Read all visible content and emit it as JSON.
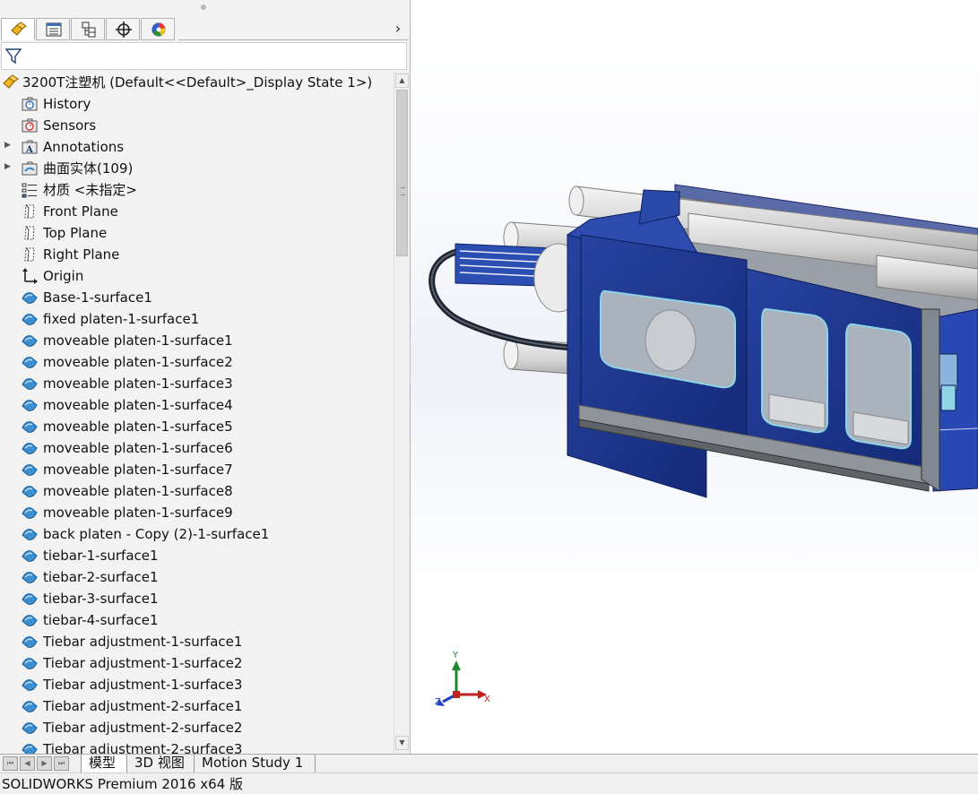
{
  "panel_tabs": [
    {
      "icon": "feature-manager-icon",
      "active": true
    },
    {
      "icon": "property-manager-icon",
      "active": false
    },
    {
      "icon": "configuration-manager-icon",
      "active": false
    },
    {
      "icon": "dimxpert-manager-icon",
      "active": false
    },
    {
      "icon": "display-manager-icon",
      "active": false
    }
  ],
  "tree": {
    "root_label": "3200T注塑机  (Default<<Default>_Display State 1>)",
    "items": [
      {
        "label": "History",
        "icon": "history-folder-icon",
        "expandable": false
      },
      {
        "label": "Sensors",
        "icon": "sensors-folder-icon",
        "expandable": false
      },
      {
        "label": "Annotations",
        "icon": "annotations-folder-icon",
        "expandable": true
      },
      {
        "label": "曲面实体(109)",
        "icon": "surface-bodies-folder-icon",
        "expandable": true
      },
      {
        "label": "材质 <未指定>",
        "icon": "material-icon",
        "expandable": false
      },
      {
        "label": "Front Plane",
        "icon": "plane-icon",
        "expandable": false
      },
      {
        "label": "Top Plane",
        "icon": "plane-icon",
        "expandable": false
      },
      {
        "label": "Right Plane",
        "icon": "plane-icon",
        "expandable": false
      },
      {
        "label": "Origin",
        "icon": "origin-icon",
        "expandable": false
      },
      {
        "label": "Base-1-surface1",
        "icon": "imported-surface-icon",
        "expandable": false
      },
      {
        "label": "fixed platen-1-surface1",
        "icon": "imported-surface-icon",
        "expandable": false
      },
      {
        "label": "moveable platen-1-surface1",
        "icon": "imported-surface-icon",
        "expandable": false
      },
      {
        "label": "moveable platen-1-surface2",
        "icon": "imported-surface-icon",
        "expandable": false
      },
      {
        "label": "moveable platen-1-surface3",
        "icon": "imported-surface-icon",
        "expandable": false
      },
      {
        "label": "moveable platen-1-surface4",
        "icon": "imported-surface-icon",
        "expandable": false
      },
      {
        "label": "moveable platen-1-surface5",
        "icon": "imported-surface-icon",
        "expandable": false
      },
      {
        "label": "moveable platen-1-surface6",
        "icon": "imported-surface-icon",
        "expandable": false
      },
      {
        "label": "moveable platen-1-surface7",
        "icon": "imported-surface-icon",
        "expandable": false
      },
      {
        "label": "moveable platen-1-surface8",
        "icon": "imported-surface-icon",
        "expandable": false
      },
      {
        "label": "moveable platen-1-surface9",
        "icon": "imported-surface-icon",
        "expandable": false
      },
      {
        "label": "back platen - Copy (2)-1-surface1",
        "icon": "imported-surface-icon",
        "expandable": false
      },
      {
        "label": "tiebar-1-surface1",
        "icon": "imported-surface-icon",
        "expandable": false
      },
      {
        "label": "tiebar-2-surface1",
        "icon": "imported-surface-icon",
        "expandable": false
      },
      {
        "label": "tiebar-3-surface1",
        "icon": "imported-surface-icon",
        "expandable": false
      },
      {
        "label": "tiebar-4-surface1",
        "icon": "imported-surface-icon",
        "expandable": false
      },
      {
        "label": "Tiebar adjustment-1-surface1",
        "icon": "imported-surface-icon",
        "expandable": false
      },
      {
        "label": "Tiebar adjustment-1-surface2",
        "icon": "imported-surface-icon",
        "expandable": false
      },
      {
        "label": "Tiebar adjustment-1-surface3",
        "icon": "imported-surface-icon",
        "expandable": false
      },
      {
        "label": "Tiebar adjustment-2-surface1",
        "icon": "imported-surface-icon",
        "expandable": false
      },
      {
        "label": "Tiebar adjustment-2-surface2",
        "icon": "imported-surface-icon",
        "expandable": false
      },
      {
        "label": "Tiebar adjustment-2-surface3",
        "icon": "imported-surface-icon",
        "expandable": false
      }
    ]
  },
  "triad": {
    "x": "X",
    "y": "Y",
    "z": "Z"
  },
  "bottom_tabs": [
    {
      "label": "模型",
      "active": true
    },
    {
      "label": "3D 视图",
      "active": false
    },
    {
      "label": "Motion Study 1",
      "active": false
    }
  ],
  "status": {
    "text": "SOLIDWORKS Premium 2016 x64 版"
  },
  "colors": {
    "machine_blue": "#1f3a8f",
    "tree_icon_blue": "#3d8fd1",
    "panel_bg": "#f3f3f3"
  }
}
